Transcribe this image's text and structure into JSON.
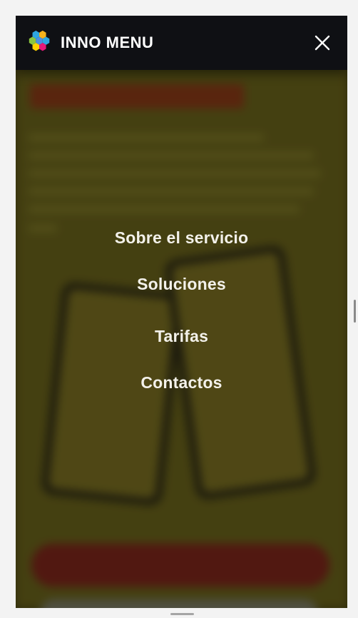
{
  "brand": {
    "logo_text": "INNO MENU",
    "logo_colors": [
      "#f6b21b",
      "#2ea6e0",
      "#8cc63f",
      "#e6197a",
      "#ffd200",
      "#4a90e2"
    ]
  },
  "header": {
    "close_icon": "close-icon"
  },
  "menu": {
    "items": [
      {
        "label": "Sobre el servicio"
      },
      {
        "label": "Soluciones"
      },
      {
        "label": "Tarifas"
      },
      {
        "label": "Contactos"
      }
    ]
  }
}
